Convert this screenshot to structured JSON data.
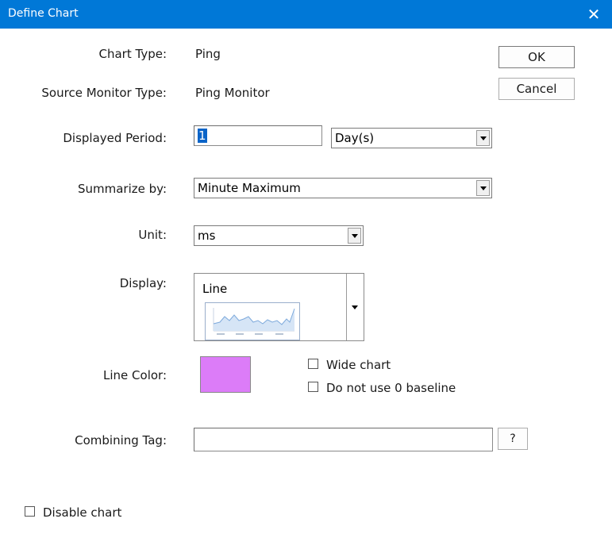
{
  "window": {
    "title": "Define Chart",
    "close_glyph": "✕"
  },
  "buttons": {
    "ok": "OK",
    "cancel": "Cancel",
    "help": "?"
  },
  "fields": {
    "chart_type": {
      "label": "Chart Type:",
      "value": "Ping"
    },
    "source_monitor_type": {
      "label": "Source Monitor Type:",
      "value": "Ping Monitor"
    },
    "displayed_period": {
      "label": "Displayed Period:",
      "value": "1",
      "unit_selected": "Day(s)"
    },
    "summarize_by": {
      "label": "Summarize by:",
      "selected": "Minute Maximum"
    },
    "unit": {
      "label": "Unit:",
      "selected": "ms"
    },
    "display": {
      "label": "Display:",
      "selected": "Line"
    },
    "line_color": {
      "label": "Line Color:",
      "color": "#dc7cf8"
    },
    "combining_tag": {
      "label": "Combining Tag:",
      "value": ""
    }
  },
  "checkboxes": {
    "wide_chart": {
      "label": "Wide chart",
      "checked": false
    },
    "no_zero_baseline": {
      "label": "Do not use 0 baseline",
      "checked": false
    },
    "disable_chart": {
      "label": "Disable chart",
      "checked": false
    }
  },
  "icons": {
    "close": "close-icon",
    "dropdown": "chevron-down-icon",
    "chart_thumbnail": "line-chart-thumbnail-icon"
  },
  "colors": {
    "titlebar": "#0078d7",
    "selection": "#0a64c8"
  }
}
